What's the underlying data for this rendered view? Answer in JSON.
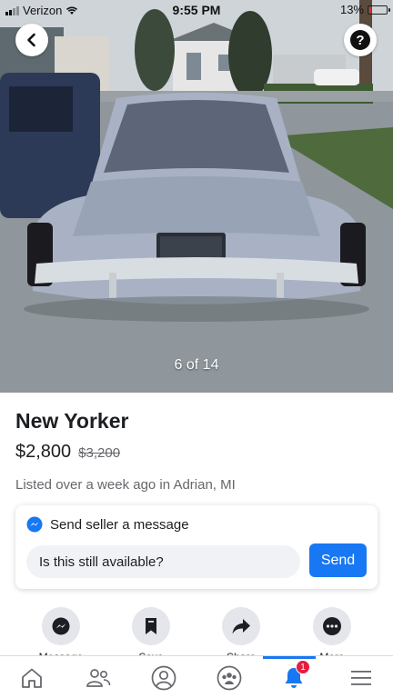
{
  "status_bar": {
    "carrier": "Verizon",
    "time": "9:55 PM",
    "battery": "13%",
    "battery_level": 0.13
  },
  "photo": {
    "counter": "6 of 14"
  },
  "listing": {
    "title": "New Yorker",
    "price": "$2,800",
    "original_price": "$3,200",
    "meta": "Listed over a week ago in Adrian, MI"
  },
  "message_card": {
    "heading": "Send seller a message",
    "input_value": "Is this still available?",
    "send_label": "Send"
  },
  "actions": [
    {
      "label": "Message",
      "icon": "messenger-icon"
    },
    {
      "label": "Save",
      "icon": "bookmark-icon"
    },
    {
      "label": "Share",
      "icon": "share-arrow-icon"
    },
    {
      "label": "More",
      "icon": "more-dots-icon"
    }
  ],
  "tabbar": {
    "tabs": [
      {
        "icon": "home-icon"
      },
      {
        "icon": "friends-icon"
      },
      {
        "icon": "profile-icon"
      },
      {
        "icon": "groups-icon"
      },
      {
        "icon": "notifications-bell-icon",
        "badge": "1",
        "active": true
      },
      {
        "icon": "menu-icon"
      }
    ]
  },
  "colors": {
    "accent": "#1877f2",
    "badge": "#e41e3f",
    "secondary_text": "#65676b",
    "action_bg": "#e4e6eb"
  }
}
